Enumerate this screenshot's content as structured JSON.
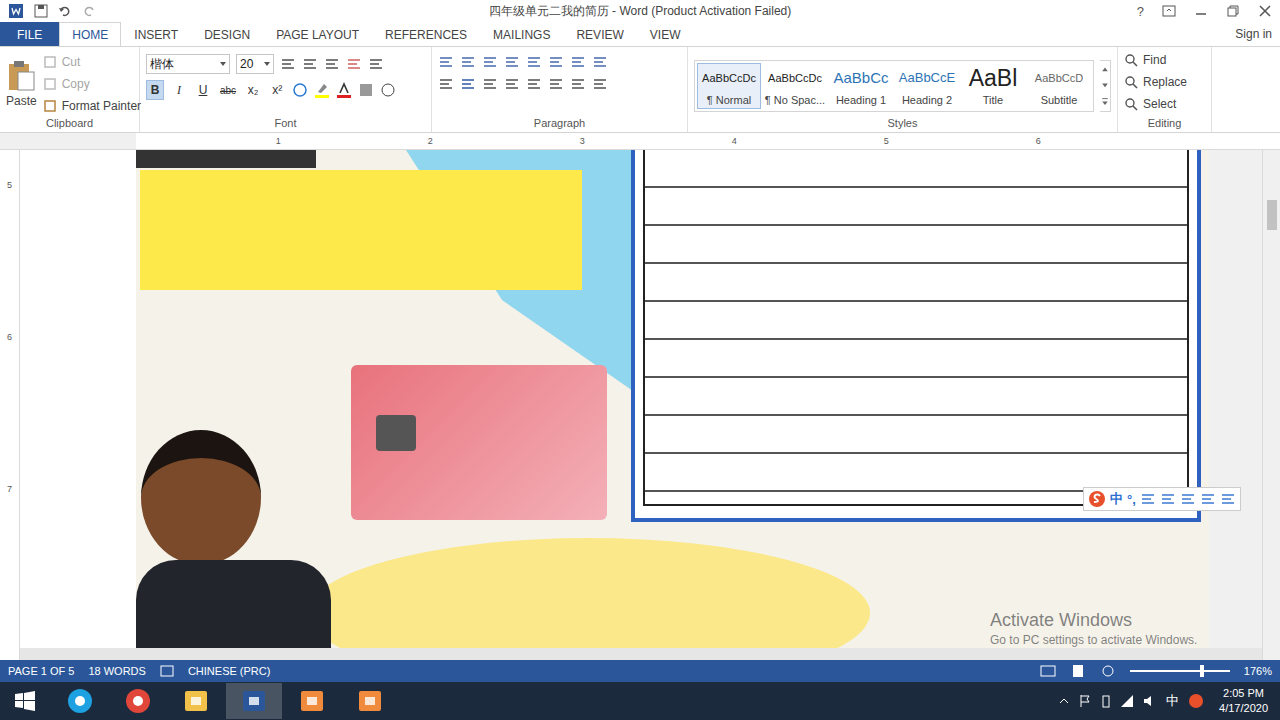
{
  "window": {
    "title": "四年级单元二我的简历 - Word (Product Activation Failed)",
    "help": "?"
  },
  "tabs": [
    {
      "label": "FILE",
      "selected": false,
      "kind": "file"
    },
    {
      "label": "HOME",
      "selected": true,
      "kind": "tab"
    },
    {
      "label": "INSERT",
      "selected": false,
      "kind": "tab"
    },
    {
      "label": "DESIGN",
      "selected": false,
      "kind": "tab"
    },
    {
      "label": "PAGE LAYOUT",
      "selected": false,
      "kind": "tab"
    },
    {
      "label": "REFERENCES",
      "selected": false,
      "kind": "tab"
    },
    {
      "label": "MAILINGS",
      "selected": false,
      "kind": "tab"
    },
    {
      "label": "REVIEW",
      "selected": false,
      "kind": "tab"
    },
    {
      "label": "VIEW",
      "selected": false,
      "kind": "tab"
    }
  ],
  "sign_in": "Sign in",
  "clipboard": {
    "label": "Clipboard",
    "paste": "Paste",
    "items": [
      {
        "label": "Cut",
        "disabled": true
      },
      {
        "label": "Copy",
        "disabled": true
      },
      {
        "label": "Format Painter",
        "disabled": false
      }
    ]
  },
  "font": {
    "label": "Font",
    "family": "楷体",
    "size": "20",
    "buttons": [
      "B",
      "I",
      "U",
      "abc",
      "x₂",
      "x²"
    ]
  },
  "paragraph": {
    "label": "Paragraph"
  },
  "styles": {
    "label": "Styles",
    "items": [
      {
        "preview": "AaBbCcDc",
        "name": "¶ Normal",
        "kind": "normal",
        "selected": true
      },
      {
        "preview": "AaBbCcDc",
        "name": "¶ No Spac...",
        "kind": "nospacing",
        "selected": false
      },
      {
        "preview": "AaBbCc",
        "name": "Heading 1",
        "kind": "heading1",
        "selected": false
      },
      {
        "preview": "AaBbCcE",
        "name": "Heading 2",
        "kind": "heading2",
        "selected": false
      },
      {
        "preview": "AaBl",
        "name": "Title",
        "kind": "title",
        "selected": false
      },
      {
        "preview": "AaBbCcD",
        "name": "Subtitle",
        "kind": "subtitle",
        "selected": false
      }
    ]
  },
  "editing": {
    "label": "Editing",
    "items": [
      "Find",
      "Replace",
      "Select"
    ]
  },
  "ruler": {
    "horizontal": [
      "1",
      "2",
      "3",
      "4",
      "5",
      "6"
    ],
    "vertical": [
      "5",
      "6",
      "7"
    ]
  },
  "ime_bar": {
    "mode": "中",
    "punct": "°,"
  },
  "watermark": {
    "line1": "Activate Windows",
    "line2": "Go to PC settings to activate Windows."
  },
  "status_bar": {
    "page": "PAGE 1 OF 5",
    "words": "18 WORDS",
    "language": "CHINESE (PRC)",
    "zoom": "176%"
  },
  "taskbar": {
    "ime": "中",
    "time": "2:05 PM",
    "date": "4/17/2020",
    "apps": [
      {
        "name": "ie",
        "active": false
      },
      {
        "name": "chrome",
        "active": false
      },
      {
        "name": "explorer",
        "active": false
      },
      {
        "name": "word",
        "active": true
      },
      {
        "name": "recorder",
        "active": false
      },
      {
        "name": "camera",
        "active": false
      }
    ]
  }
}
